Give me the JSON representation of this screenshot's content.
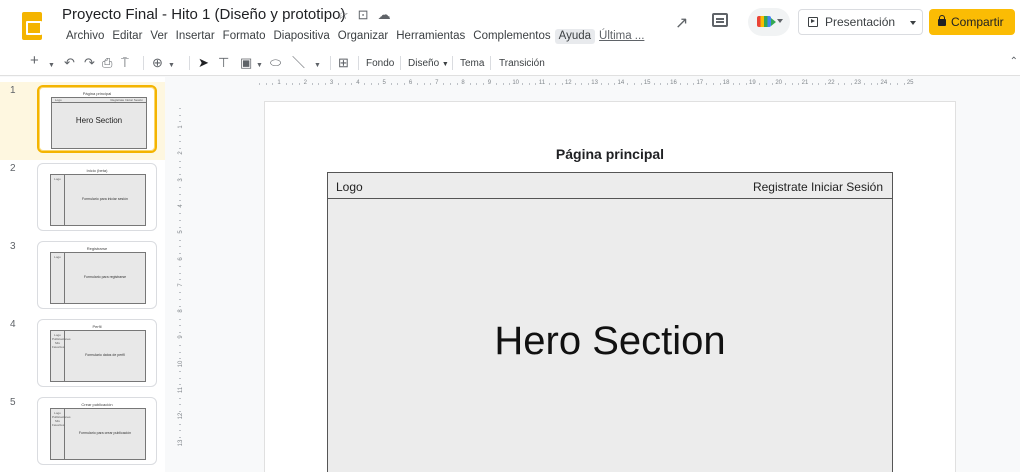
{
  "header": {
    "doc_title": "Proyecto Final - Hito 1 (Diseño y prototipo)",
    "menu": [
      "Archivo",
      "Editar",
      "Ver",
      "Insertar",
      "Formato",
      "Diapositiva",
      "Organizar",
      "Herramientas",
      "Complementos",
      "Ayuda",
      "Última ..."
    ],
    "present_label": "Presentación",
    "share_label": "Compartir"
  },
  "toolbar": {
    "fondo": "Fondo",
    "diseno": "Diseño",
    "tema": "Tema",
    "transicion": "Transición"
  },
  "filmstrip": {
    "slides": [
      {
        "num": "1",
        "title": "Página principal",
        "bar_left": "Logo",
        "bar_right": "Registrate Iniciar Sesión",
        "body": "Hero Section"
      },
      {
        "num": "2",
        "title": "Inicio (beta)",
        "side": "Logo",
        "body": "Formulario para iniciar sesión"
      },
      {
        "num": "3",
        "title": "Registrarse",
        "side": "Logo",
        "body": "Formulario para registrarse"
      },
      {
        "num": "4",
        "title": "Perfil",
        "side": "Logo Publicaciones Mis Favoritos",
        "body": "Formulario datos de perfil"
      },
      {
        "num": "5",
        "title": "Crear publicación",
        "side": "Logo Publicaciones Mis Favoritos",
        "body": "Formulario para crear publicación"
      }
    ]
  },
  "ruler": {
    "h": [
      "1",
      "2",
      "3",
      "4",
      "5",
      "6",
      "7",
      "8",
      "9",
      "10",
      "11",
      "12",
      "13",
      "14",
      "15",
      "16",
      "17",
      "18",
      "19",
      "20",
      "21",
      "22",
      "23",
      "24",
      "25"
    ],
    "v": [
      "1",
      "2",
      "3",
      "4",
      "5",
      "6",
      "7",
      "8",
      "9",
      "10",
      "11",
      "12",
      "13"
    ]
  },
  "slide": {
    "title": "Página principal",
    "nav_logo": "Logo",
    "nav_right": "Registrate Iniciar Sesión",
    "hero": "Hero Section"
  },
  "colors": {
    "accent": "#fbbc04",
    "slides_logo": "#f4b400",
    "selected_border": "#f4b400"
  }
}
